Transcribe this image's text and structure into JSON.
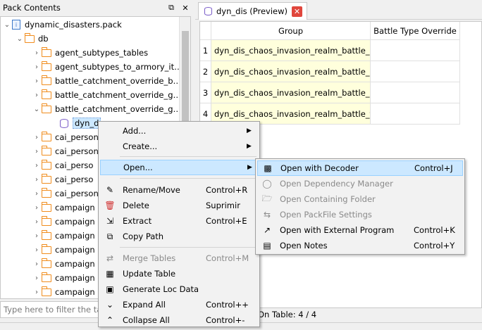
{
  "dock": {
    "title": "Pack Contents",
    "float_glyph": "⧉",
    "close_glyph": "✕"
  },
  "tree": {
    "root": "dynamic_disasters.pack",
    "db": "db",
    "items": [
      "agent_subtypes_tables",
      "agent_subtypes_to_armory_it…",
      "battle_catchment_override_b…",
      "battle_catchment_override_g…",
      "battle_catchment_override_g…",
      "dyn_d",
      "cai_person",
      "cai_person",
      "cai_perso",
      "cai_perso",
      "cai_person",
      "campaign",
      "campaign",
      "campaign",
      "campaign",
      "campaign",
      "campaign",
      "campaign"
    ]
  },
  "filter": {
    "placeholder": "Type here to filter the tables"
  },
  "tab": {
    "label": "dyn_dis (Preview)",
    "close_glyph": "✕"
  },
  "table": {
    "columns": [
      "Group",
      "Battle Type Override"
    ],
    "rows": [
      {
        "num": "1",
        "group": "dyn_dis_chaos_invasion_realm_battle_kho",
        "override": ""
      },
      {
        "num": "2",
        "group": "dyn_dis_chaos_invasion_realm_battle_nur",
        "override": ""
      },
      {
        "num": "3",
        "group": "dyn_dis_chaos_invasion_realm_battle_sla",
        "override": ""
      },
      {
        "num": "4",
        "group": "dyn_dis_chaos_invasion_realm_battle_tze",
        "override": ""
      }
    ],
    "status": "On Table: 4 / 4"
  },
  "context_menu": {
    "items": [
      {
        "label": "Add...",
        "submenu": true
      },
      {
        "label": "Create...",
        "submenu": true
      },
      {
        "label": "Open...",
        "submenu": true
      },
      {
        "label": "Rename/Move",
        "shortcut": "Control+R",
        "icon": "rename-icon"
      },
      {
        "label": "Delete",
        "shortcut": "Suprimir",
        "icon": "trash-icon"
      },
      {
        "label": "Extract",
        "shortcut": "Control+E",
        "icon": "extract-icon"
      },
      {
        "label": "Copy Path",
        "shortcut": "",
        "icon": "copy-icon"
      },
      {
        "label": "Merge Tables",
        "shortcut": "Control+M",
        "icon": "merge-icon",
        "disabled": true
      },
      {
        "label": "Update Table",
        "shortcut": "",
        "icon": "update-icon"
      },
      {
        "label": "Generate Loc Data",
        "shortcut": "",
        "icon": "generate-icon"
      },
      {
        "label": "Expand All",
        "shortcut": "Control++",
        "icon": "expand-icon"
      },
      {
        "label": "Collapse All",
        "shortcut": "Control+-",
        "icon": "collapse-icon"
      }
    ],
    "submenu_arrow": "▶"
  },
  "open_submenu": {
    "items": [
      {
        "label": "Open with Decoder",
        "shortcut": "Control+J",
        "icon": "decoder-icon"
      },
      {
        "label": "Open Dependency Manager",
        "shortcut": "",
        "icon": "dependency-icon",
        "disabled": true
      },
      {
        "label": "Open Containing Folder",
        "shortcut": "",
        "icon": "folder-icon",
        "disabled": true
      },
      {
        "label": "Open PackFile Settings",
        "shortcut": "",
        "icon": "settings-icon",
        "disabled": true
      },
      {
        "label": "Open with External Program",
        "shortcut": "Control+K",
        "icon": "external-icon"
      },
      {
        "label": "Open Notes",
        "shortcut": "Control+Y",
        "icon": "notes-icon"
      }
    ]
  }
}
